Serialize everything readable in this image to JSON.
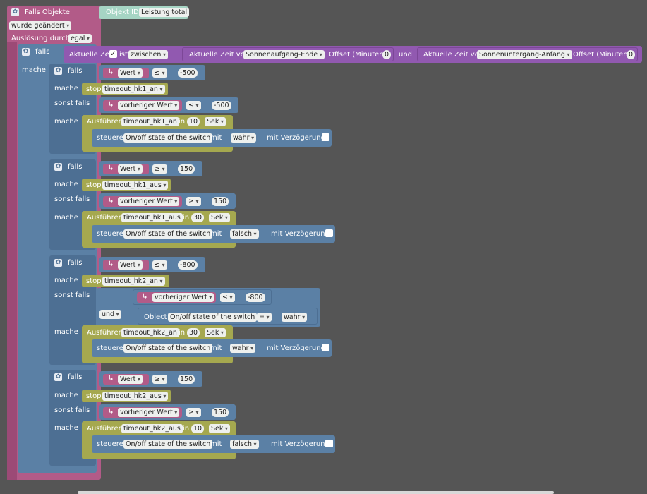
{
  "trigger": {
    "title": "Falls Objekte",
    "object_id_label": "Objekt ID",
    "object_id_value": "Leistung total",
    "changed": "wurde geändert",
    "trigger_label": "Auslösung durch",
    "trigger_value": "egal"
  },
  "outer_if": {
    "falls": "falls",
    "mache": "mache",
    "time_label": "Aktuelle Zeit",
    "ist": "ist",
    "between": "zwischen",
    "time_from_label": "Aktuelle Zeit von",
    "sunrise": "Sonnenaufgang-Ende",
    "offset_label": "Offset (Minuten)",
    "offset1": "0",
    "und": "und",
    "time_to_label": "Aktuelle Zeit von",
    "sunset": "Sonnenuntergang-Anfang",
    "offset2": "0"
  },
  "labels": {
    "falls": "falls",
    "mache": "mache",
    "sonst_falls": "sonst falls",
    "stop": "stop",
    "wert": "Wert",
    "prev_wert": "vorheriger Wert",
    "ausfuehren": "Ausführen",
    "in": "in",
    "sek": "Sek",
    "steuere": "steuere",
    "switch": "On/off state of the switch",
    "mit": "mit",
    "mit_verz": "mit Verzögerung",
    "und": "und",
    "object": "Object",
    "eq": "="
  },
  "blocks": [
    {
      "op": "≤",
      "value": "-500",
      "stop_timeout": "timeout_hk1_an",
      "prev_op": "≤",
      "prev_value": "-500",
      "exec_timeout": "timeout_hk1_an",
      "delay": "10",
      "control_value": "wahr"
    },
    {
      "op": "≥",
      "value": "150",
      "stop_timeout": "timeout_hk1_aus",
      "prev_op": "≥",
      "prev_value": "150",
      "exec_timeout": "timeout_hk1_aus",
      "delay": "30",
      "control_value": "falsch"
    },
    {
      "op": "≤",
      "value": "-800",
      "stop_timeout": "timeout_hk2_an",
      "prev_op": "≤",
      "prev_value": "-800",
      "cond_op": "und",
      "cond_eq_value": "wahr",
      "exec_timeout": "timeout_hk2_an",
      "delay": "30",
      "control_value": "wahr"
    },
    {
      "op": "≥",
      "value": "150",
      "stop_timeout": "timeout_hk2_aus",
      "prev_op": "≥",
      "prev_value": "150",
      "exec_timeout": "timeout_hk2_aus",
      "delay": "10",
      "control_value": "falsch"
    }
  ],
  "colors": {
    "trigger": "#b25b88",
    "logic": "#5b80a5",
    "time": "#9159b0",
    "timeout": "#a5a84f",
    "object_id": "#a6d5c4"
  }
}
